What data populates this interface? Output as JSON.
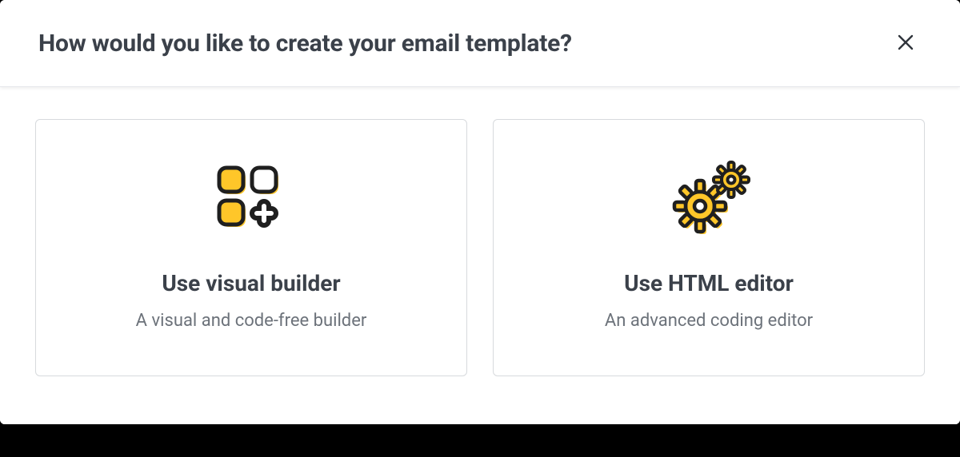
{
  "header": {
    "title": "How would you like to create your email template?"
  },
  "options": [
    {
      "title": "Use visual builder",
      "description": "A visual and code-free builder"
    },
    {
      "title": "Use HTML editor",
      "description": "An advanced coding editor"
    }
  ]
}
